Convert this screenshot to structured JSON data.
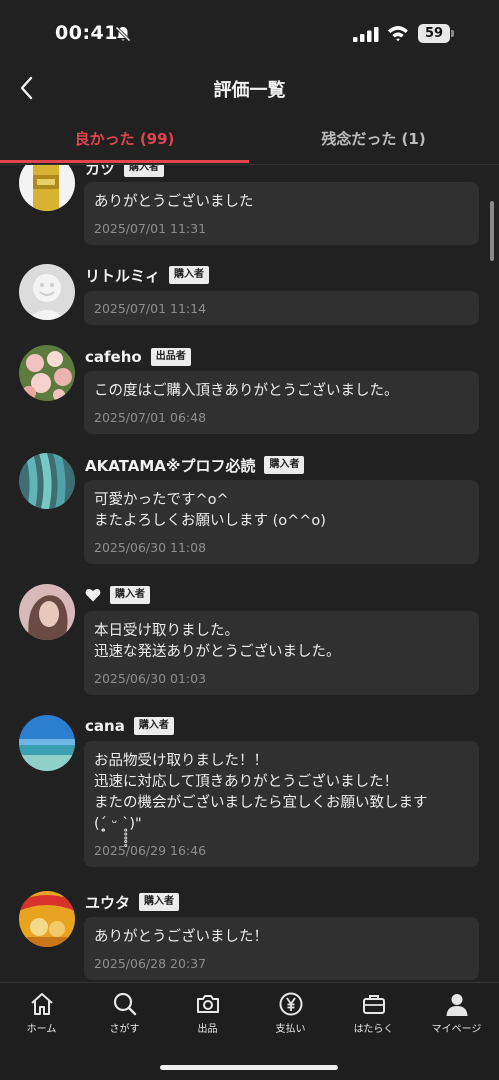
{
  "status_bar": {
    "time": "00:41",
    "battery": "59"
  },
  "header": {
    "title": "評価一覧"
  },
  "tabs": [
    {
      "label": "良かった (99)"
    },
    {
      "label": "残念だった (1)"
    }
  ],
  "reviews": [
    {
      "username": "カツ",
      "badge": "購入者",
      "comment": "ありがとうございました",
      "date": "2025/07/01 11:31"
    },
    {
      "username": "リトルミィ",
      "badge": "購入者",
      "comment": "",
      "date": "2025/07/01 11:14"
    },
    {
      "username": "cafeho",
      "badge": "出品者",
      "comment": "この度はご購入頂きありがとうございました。",
      "date": "2025/07/01 06:48"
    },
    {
      "username": "AKATAMA※プロフ必読",
      "badge": "購入者",
      "comment": "可愛かったです^o^\nまたよろしくお願いします (o^^o)",
      "date": "2025/06/30 11:08"
    },
    {
      "username": "",
      "badge": "購入者",
      "comment": "本日受け取りました。\n迅速な発送ありがとうございました。",
      "date": "2025/06/30 01:03"
    },
    {
      "username": "cana",
      "badge": "購入者",
      "comment": "お品物受け取りました！！\n迅速に対応して頂きありがとうございました！\nまたの機会がございましたら宜しくお願い致します\n(ˊ̥̥̥̥̥ ᵕ ˋ̥̥̥̥̥)\"",
      "date": "2025/06/29 16:46"
    },
    {
      "username": "ユウタ",
      "badge": "購入者",
      "comment": "ありがとうございました！",
      "date": "2025/06/28 20:37"
    }
  ],
  "bottom_nav": [
    {
      "label": "ホーム",
      "icon": "home-icon"
    },
    {
      "label": "さがす",
      "icon": "search-icon"
    },
    {
      "label": "出品",
      "icon": "camera-icon"
    },
    {
      "label": "支払い",
      "icon": "yen-icon"
    },
    {
      "label": "はたらく",
      "icon": "briefcase-icon"
    },
    {
      "label": "マイページ",
      "icon": "person-icon"
    }
  ],
  "colors": {
    "accent": "#e0454f",
    "background": "#212121",
    "bubble": "#303030"
  }
}
